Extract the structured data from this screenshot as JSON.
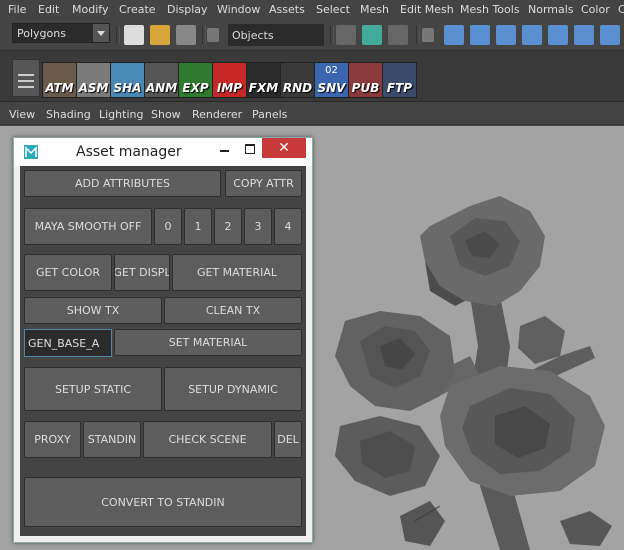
{
  "menubar": {
    "items": [
      "File",
      "Edit",
      "Modify",
      "Create",
      "Display",
      "Window",
      "Assets",
      "Select",
      "Mesh",
      "Edit Mesh",
      "Mesh Tools",
      "Normals",
      "Color",
      "C"
    ]
  },
  "statusline": {
    "mode_value": "Polygons",
    "objects_label": "Objects"
  },
  "shelf": {
    "buttons": [
      {
        "label": "ATM",
        "color": "#6a5a4a"
      },
      {
        "label": "ASM",
        "color": "#7a7a7a"
      },
      {
        "label": "SHA",
        "color": "#4a88b8"
      },
      {
        "label": "ANM",
        "color": "#555555"
      },
      {
        "label": "EXP",
        "color": "#2e7a2e"
      },
      {
        "label": "IMP",
        "color": "#c62828"
      },
      {
        "label": "FXM",
        "color": "#2a2a2a"
      },
      {
        "label": "RND",
        "color": "#3a3a3a"
      },
      {
        "label": "SNV",
        "number": "02",
        "color": "#3a66b0"
      },
      {
        "label": "PUB",
        "color": "#8a3a3a"
      },
      {
        "label": "FTP",
        "color": "#3a4a6a"
      }
    ]
  },
  "panelmenu": {
    "items": [
      "View",
      "Shading",
      "Lighting",
      "Show",
      "Renderer",
      "Panels"
    ]
  },
  "window": {
    "title": "Asset manager",
    "close_glyph": "✕",
    "buttons": {
      "add_attributes": "ADD ATTRIBUTES",
      "copy_attr": "COPY ATTR",
      "maya_smooth_off": "MAYA SMOOTH OFF",
      "smooth_0": "0",
      "smooth_1": "1",
      "smooth_2": "2",
      "smooth_3": "3",
      "smooth_4": "4",
      "get_color": "GET COLOR",
      "get_displ": "GET DISPL",
      "get_material": "GET MATERIAL",
      "show_tx": "SHOW TX",
      "clean_tx": "CLEAN TX",
      "set_material": "SET MATERIAL",
      "setup_static": "SETUP STATIC",
      "setup_dynamic": "SETUP DYNAMIC",
      "proxy": "PROXY",
      "standin": "STANDIN",
      "check_scene": "CHECK SCENE",
      "del": "DEL",
      "convert_to_standin": "CONVERT TO STANDIN"
    },
    "material_field": {
      "value": "GEN_BASE_A"
    }
  }
}
